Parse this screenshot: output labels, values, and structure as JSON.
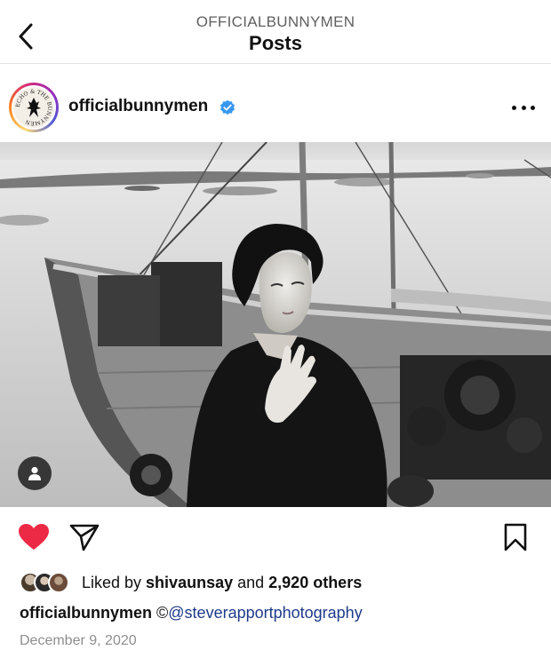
{
  "header": {
    "subtitle": "OFFICIALBUNNYMEN",
    "title": "Posts"
  },
  "post": {
    "username": "officialbunnymen",
    "verified": true,
    "avatar_text": "ECHO & THE BUNNYMEN",
    "image_alt": "Black and white photo of a young man with a dark coat and tousled hair, hand on chest, standing in front of fishing boats in a harbor",
    "liked_by_prefix": "Liked by ",
    "liked_by_user": "shivaunsay",
    "liked_by_conj": " and ",
    "liked_by_others": "2,920 others",
    "caption_user": "officialbunnymen",
    "caption_symbol": " ©",
    "caption_mention": "@steverapportphotography",
    "date": "December 9, 2020"
  },
  "icons": {
    "back": "chevron-left-icon",
    "verified": "verified-badge-icon",
    "more": "more-horizontal-icon",
    "tag": "user-tag-icon",
    "like": "heart-filled-icon",
    "share": "paper-plane-icon",
    "save": "bookmark-icon"
  },
  "colors": {
    "like": "#ed2a45",
    "verified": "#3897f0",
    "mention": "#1e3a8a",
    "muted": "#8e8e8e"
  }
}
